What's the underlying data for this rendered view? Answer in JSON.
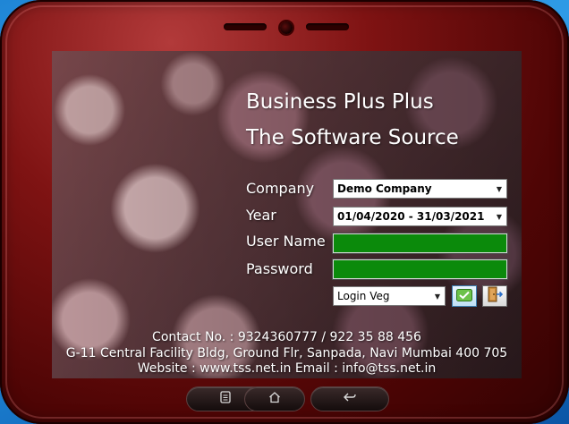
{
  "app": {
    "title_line1": "Business Plus Plus",
    "title_line2": "The Software Source"
  },
  "form": {
    "company_label": "Company",
    "company_value": "Demo Company",
    "year_label": "Year",
    "year_value": "01/04/2020 - 31/03/2021",
    "username_label": "User Name",
    "username_value": "",
    "password_label": "Password",
    "password_value": "",
    "login_type_value": "Login Veg"
  },
  "footer": {
    "contact": "Contact No. : 9324360777 / 922 35 88 456",
    "address": "G-11 Central Facility Bldg, Ground Flr, Sanpada, Navi Mumbai 400 705",
    "web_email": "Website : www.tss.net.in Email : info@tss.net.in"
  },
  "icons": {
    "ok": "checkmark-icon",
    "exit": "exit-door-icon",
    "nav_menu": "menu-icon",
    "nav_home": "home-icon",
    "nav_back": "back-icon"
  },
  "colors": {
    "frame": "#7f1313",
    "field_fill": "#0b8a0b",
    "desktop": "#1f86d6"
  }
}
